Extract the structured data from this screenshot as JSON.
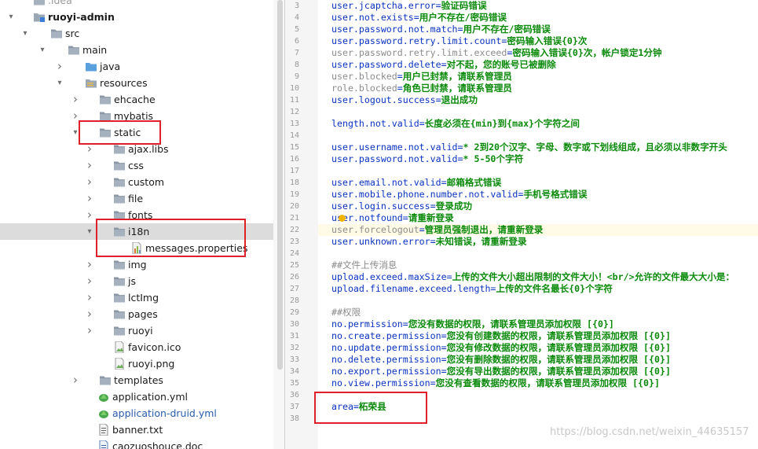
{
  "tree": {
    "items": [
      {
        "label": ".idea",
        "arrow": "",
        "icon": "folder-icon",
        "faded": true
      },
      {
        "label": "ruoyi-admin",
        "arrow": "down",
        "icon": "module-folder-icon",
        "bold": true
      },
      {
        "label": "src",
        "arrow": "down",
        "icon": "folder-icon"
      },
      {
        "label": "main",
        "arrow": "down",
        "icon": "folder-icon"
      },
      {
        "label": "java",
        "arrow": "right",
        "icon": "source-folder-icon"
      },
      {
        "label": "resources",
        "arrow": "down",
        "icon": "resources-folder-icon"
      },
      {
        "label": "ehcache",
        "arrow": "right",
        "icon": "folder-icon"
      },
      {
        "label": "mybatis",
        "arrow": "right",
        "icon": "folder-icon"
      },
      {
        "label": "static",
        "arrow": "down",
        "icon": "folder-icon"
      },
      {
        "label": "ajax.libs",
        "arrow": "right",
        "icon": "folder-icon"
      },
      {
        "label": "css",
        "arrow": "right",
        "icon": "folder-icon"
      },
      {
        "label": "custom",
        "arrow": "right",
        "icon": "folder-icon"
      },
      {
        "label": "file",
        "arrow": "right",
        "icon": "folder-icon"
      },
      {
        "label": "fonts",
        "arrow": "right",
        "icon": "folder-icon"
      },
      {
        "label": "i18n",
        "arrow": "down",
        "icon": "folder-icon"
      },
      {
        "label": "messages.properties",
        "arrow": "",
        "icon": "properties-file-icon"
      },
      {
        "label": "img",
        "arrow": "right",
        "icon": "folder-icon"
      },
      {
        "label": "js",
        "arrow": "right",
        "icon": "folder-icon"
      },
      {
        "label": "lctImg",
        "arrow": "right",
        "icon": "folder-icon"
      },
      {
        "label": "pages",
        "arrow": "right",
        "icon": "folder-icon"
      },
      {
        "label": "ruoyi",
        "arrow": "right",
        "icon": "folder-icon"
      },
      {
        "label": "favicon.ico",
        "arrow": "",
        "icon": "image-file-icon"
      },
      {
        "label": "ruoyi.png",
        "arrow": "",
        "icon": "image-file-icon"
      },
      {
        "label": "templates",
        "arrow": "right",
        "icon": "folder-icon"
      },
      {
        "label": "application.yml",
        "arrow": "",
        "icon": "yaml-file-icon"
      },
      {
        "label": "application-druid.yml",
        "arrow": "",
        "icon": "yaml-file-icon",
        "blue": true
      },
      {
        "label": "banner.txt",
        "arrow": "",
        "icon": "text-file-icon"
      },
      {
        "label": "caozuoshouce.doc",
        "arrow": "",
        "icon": "doc-file-icon"
      }
    ]
  },
  "editor": {
    "lines": [
      {
        "n": "3",
        "key": "user.jcaptcha.error",
        "val": "验证码错误"
      },
      {
        "n": "4",
        "key": "user.not.exists",
        "val": "用户不存在/密码错误"
      },
      {
        "n": "5",
        "key": "user.password.not.match",
        "val": "用户不存在/密码错误"
      },
      {
        "n": "6",
        "key": "user.password.retry.limit.count",
        "val": "密码输入错误{0}次"
      },
      {
        "n": "7",
        "key": "user.password.retry.limit.exceed",
        "val": "密码输入错误{0}次，帐户锁定1分钟",
        "dim": true
      },
      {
        "n": "8",
        "key": "user.password.delete",
        "val": "对不起，您的账号已被删除"
      },
      {
        "n": "9",
        "key": "user.blocked",
        "val": "用户已封禁，请联系管理员",
        "dim": true
      },
      {
        "n": "10",
        "key": "role.blocked",
        "val": "角色已封禁，请联系管理员",
        "dim": true
      },
      {
        "n": "11",
        "key": "user.logout.success",
        "val": "退出成功"
      },
      {
        "n": "12",
        "key": "",
        "val": ""
      },
      {
        "n": "13",
        "key": "length.not.valid",
        "val": "长度必须在{min}到{max}个字符之间"
      },
      {
        "n": "14",
        "key": "",
        "val": ""
      },
      {
        "n": "15",
        "key": "user.username.not.valid",
        "val": "* 2到20个汉字、字母、数字或下划线组成，且必须以非数字开头"
      },
      {
        "n": "16",
        "key": "user.password.not.valid",
        "val": "* 5-50个字符"
      },
      {
        "n": "17",
        "key": "",
        "val": ""
      },
      {
        "n": "18",
        "key": "user.email.not.valid",
        "val": "邮箱格式错误"
      },
      {
        "n": "19",
        "key": "user.mobile.phone.number.not.valid",
        "val": "手机号格式错误"
      },
      {
        "n": "20",
        "key": "user.login.success",
        "val": "登录成功"
      },
      {
        "n": "21",
        "key": "user.notfound",
        "val": "请重新登录"
      },
      {
        "n": "22",
        "key": "user.forcelogout",
        "val": "管理员强制退出，请重新登录",
        "dim": true,
        "caret": true
      },
      {
        "n": "23",
        "key": "user.unknown.error",
        "val": "未知错误，请重新登录"
      },
      {
        "n": "24",
        "key": "",
        "val": ""
      },
      {
        "n": "25",
        "comment": "##文件上传消息"
      },
      {
        "n": "26",
        "key": "upload.exceed.maxSize",
        "val": "上传的文件大小超出限制的文件大小！<br/>允许的文件最大大小是："
      },
      {
        "n": "27",
        "key": "upload.filename.exceed.length",
        "val": "上传的文件名最长{0}个字符"
      },
      {
        "n": "28",
        "key": "",
        "val": ""
      },
      {
        "n": "29",
        "comment": "##权限"
      },
      {
        "n": "30",
        "key": "no.permission",
        "val": "您没有数据的权限，请联系管理员添加权限 [{0}]"
      },
      {
        "n": "31",
        "key": "no.create.permission",
        "val": "您没有创建数据的权限，请联系管理员添加权限 [{0}]"
      },
      {
        "n": "32",
        "key": "no.update.permission",
        "val": "您没有修改数据的权限，请联系管理员添加权限 [{0}]"
      },
      {
        "n": "33",
        "key": "no.delete.permission",
        "val": "您没有删除数据的权限，请联系管理员添加权限 [{0}]"
      },
      {
        "n": "34",
        "key": "no.export.permission",
        "val": "您没有导出数据的权限，请联系管理员添加权限 [{0}]"
      },
      {
        "n": "35",
        "key": "no.view.permission",
        "val": "您没有查看数据的权限，请联系管理员添加权限 [{0}]"
      },
      {
        "n": "36",
        "key": "",
        "val": ""
      },
      {
        "n": "37",
        "key": "area",
        "val": "柘荣县"
      },
      {
        "n": "38",
        "key": "",
        "val": ""
      }
    ]
  },
  "watermark": "https://blog.csdn.net/weixin_44635157",
  "colors": {
    "key": "#0a33c2",
    "value": "#0a8a0a",
    "comment": "#8c8c8c",
    "highlight_box": "#e0202a"
  }
}
